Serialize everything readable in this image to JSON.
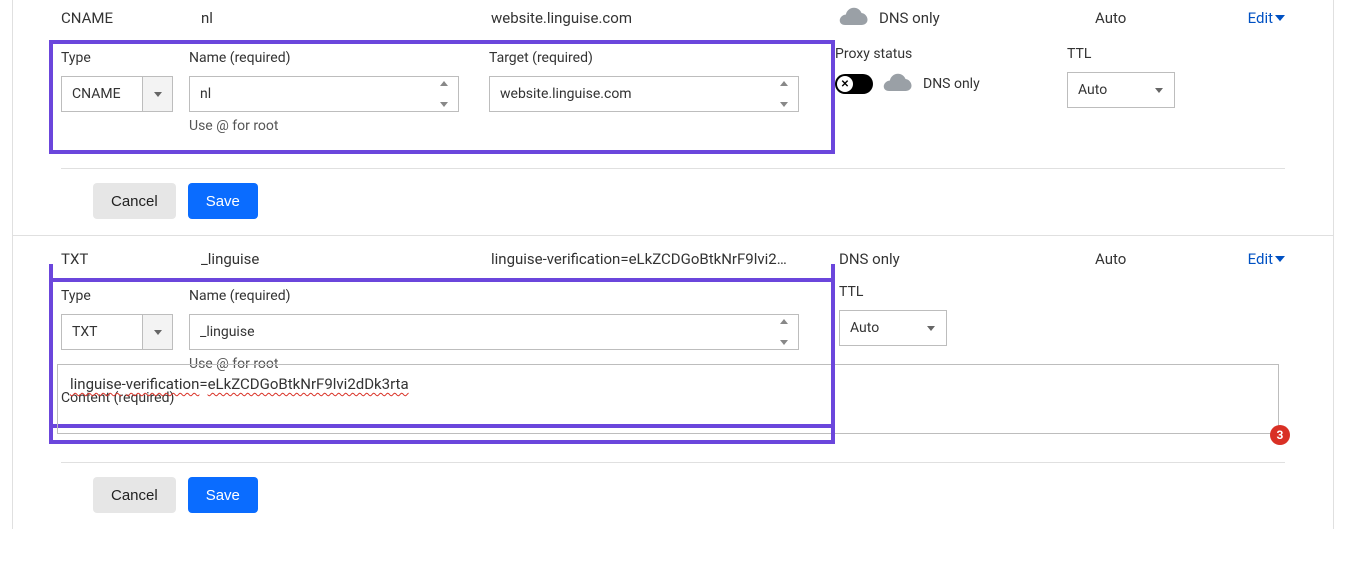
{
  "row1": {
    "type": "CNAME",
    "name": "nl",
    "target": "website.linguise.com",
    "proxy": "DNS only",
    "ttl": "Auto",
    "edit": "Edit"
  },
  "form1": {
    "type_label": "Type",
    "type_value": "CNAME",
    "name_label": "Name (required)",
    "name_value": "nl",
    "name_helper": "Use @ for root",
    "target_label": "Target (required)",
    "target_value": "website.linguise.com",
    "proxy_label": "Proxy status",
    "proxy_text": "DNS only",
    "ttl_label": "TTL",
    "ttl_value": "Auto",
    "cancel": "Cancel",
    "save": "Save"
  },
  "row2": {
    "type": "TXT",
    "name": "_linguise",
    "target": "linguise-verification=eLkZCDGoBtkNrF9lvi2…",
    "proxy": "DNS only",
    "ttl": "Auto",
    "edit": "Edit"
  },
  "form2": {
    "type_label": "Type",
    "type_value": "TXT",
    "name_label": "Name (required)",
    "name_value": "_linguise",
    "name_helper": "Use @ for root",
    "ttl_label": "TTL",
    "ttl_value": "Auto",
    "content_label": "Content (required)",
    "content_value_p1": "linguise",
    "content_value_p2": "verification",
    "content_value_p3": "eLkZCDGoBtkNrF9lvi2dDk3rta",
    "badge": "3",
    "cancel": "Cancel",
    "save": "Save"
  }
}
